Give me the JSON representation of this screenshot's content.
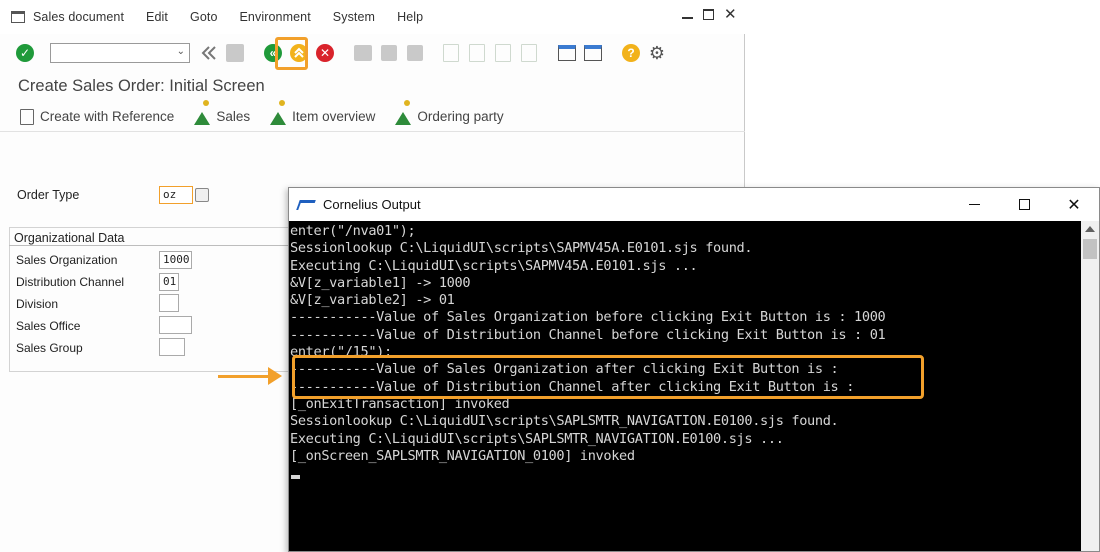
{
  "sap": {
    "menu": [
      {
        "hot": "S",
        "rest": "ales document"
      },
      {
        "hot": "E",
        "rest": "dit"
      },
      {
        "hot": "G",
        "rest": "oto"
      },
      {
        "hot": "",
        "pre": "En",
        "hot2": "v",
        "rest": "ironment"
      },
      {
        "hot": "S",
        "rest": "ystem"
      },
      {
        "hot": "H",
        "rest": "elp"
      }
    ],
    "menu_labels": [
      "Sales document",
      "Edit",
      "Goto",
      "Environment",
      "System",
      "Help"
    ],
    "title": "Create Sales Order: Initial Screen",
    "app_toolbar": {
      "create_with_reference": "Create with Reference",
      "sales": "Sales",
      "item_overview": "Item overview",
      "ordering_party": "Ordering party"
    },
    "order_type": {
      "label": "Order Type",
      "value": "oz"
    },
    "org_data": {
      "title": "Organizational Data",
      "fields": [
        {
          "label": "Sales Organization",
          "value": "1000"
        },
        {
          "label": "Distribution Channel",
          "value": "01"
        },
        {
          "label": "Division",
          "value": ""
        },
        {
          "label": "Sales Office",
          "value": ""
        },
        {
          "label": "Sales Group",
          "value": ""
        }
      ]
    },
    "icons": {
      "enter": "check-icon",
      "back": "back-icon",
      "exit": "exit-icon",
      "cancel": "cancel-icon",
      "help": "help-icon",
      "settings": "settings-icon"
    },
    "colors": {
      "accent": "#f2a02b",
      "ok_green": "#1f9a3a",
      "cancel_red": "#d9232b",
      "help_yellow": "#f2b21b"
    }
  },
  "console": {
    "title": "Cornelius Output",
    "lines": [
      "enter(\"/nva01\");",
      "Sessionlookup C:\\LiquidUI\\scripts\\SAPMV45A.E0101.sjs found.",
      "Executing C:\\LiquidUI\\scripts\\SAPMV45A.E0101.sjs ...",
      "&V[z_variable1] -> 1000",
      "&V[z_variable2] -> 01",
      "-----------Value of Sales Organization before clicking Exit Button is : 1000",
      "-----------Value of Distribution Channel before clicking Exit Button is : 01",
      "enter(\"/15\");",
      "-----------Value of Sales Organization after clicking Exit Button is :",
      "-----------Value of Distribution Channel after clicking Exit Button is :",
      "[_onExitTransaction] invoked",
      "Sessionlookup C:\\LiquidUI\\scripts\\SAPLSMTR_NAVIGATION.E0100.sjs found.",
      "Executing C:\\LiquidUI\\scripts\\SAPLSMTR_NAVIGATION.E0100.sjs ...",
      "[_onScreen_SAPLSMTR_NAVIGATION_0100] invoked"
    ]
  }
}
